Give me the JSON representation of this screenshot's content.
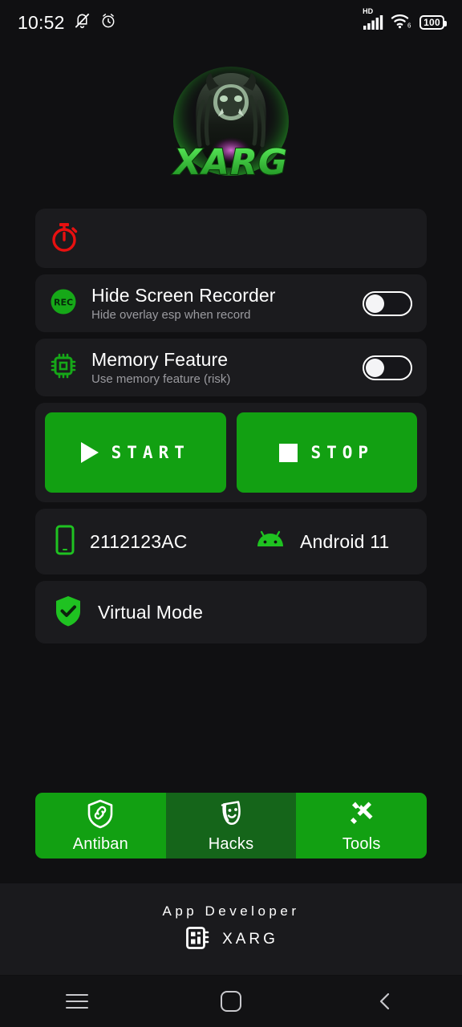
{
  "statusbar": {
    "time": "10:52",
    "mute_icon": "bell-muted-icon",
    "alarm_icon": "alarm-clock-icon",
    "hd_label": "HD",
    "signal_icon": "cellular-signal-icon",
    "wifi_icon": "wifi-6-icon",
    "battery_level": "100"
  },
  "logo": {
    "name": "xarg-logo",
    "wordmark": "XARG"
  },
  "timer_card": {
    "icon": "stopwatch-icon",
    "icon_color": "#e81010"
  },
  "toggles": [
    {
      "icon": "rec-icon",
      "icon_text": "REC",
      "title": "Hide Screen Recorder",
      "subtitle": "Hide overlay esp when record",
      "state": "off"
    },
    {
      "icon": "memory-chip-icon",
      "title": "Memory Feature",
      "subtitle": "Use memory feature (risk)",
      "state": "off"
    }
  ],
  "actions": {
    "start_label": "START",
    "start_icon": "play-icon",
    "stop_label": "STOP",
    "stop_icon": "stop-icon",
    "color": "#12a012"
  },
  "device": {
    "phone_icon": "smartphone-icon",
    "model": "2112123AC",
    "android_icon": "android-robot-icon",
    "os": "Android 11"
  },
  "virtual_mode": {
    "icon": "shield-check-icon",
    "label": "Virtual Mode"
  },
  "tabs": [
    {
      "label": "Antiban",
      "icon": "shield-link-icon",
      "state": "bright"
    },
    {
      "label": "Hacks",
      "icon": "theater-mask-icon",
      "state": "dim"
    },
    {
      "label": "Tools",
      "icon": "tools-icon",
      "state": "bright"
    }
  ],
  "footer": {
    "title": "App Developer",
    "icon": "chip-icon",
    "name": "XARG"
  },
  "navbar": {
    "recents": "recents-menu-icon",
    "home": "home-icon",
    "back": "back-icon"
  },
  "colors": {
    "green": "#12a012",
    "green_dim": "#15651a",
    "card": "#1b1b1e",
    "background": "#101012",
    "red": "#e81010"
  }
}
